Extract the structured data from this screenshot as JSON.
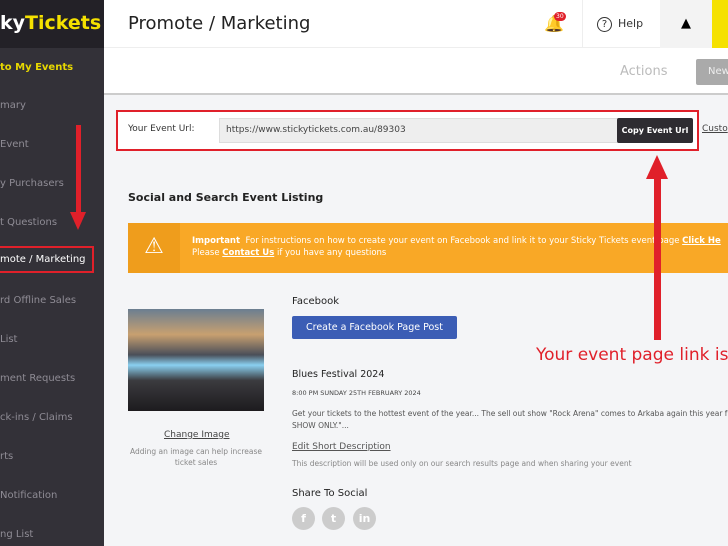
{
  "brand": {
    "logo_pre": "ky",
    "logo_post": "Tickets"
  },
  "sidebar": {
    "items": [
      {
        "label": "to My Events"
      },
      {
        "label": "mary"
      },
      {
        "label": "Event"
      },
      {
        "label": "y Purchasers"
      },
      {
        "label": "t Questions"
      },
      {
        "label": "mote / Marketing"
      },
      {
        "label": "rd Offline Sales"
      },
      {
        "label": "List"
      },
      {
        "label": "ment Requests"
      },
      {
        "label": "ck-ins / Claims"
      },
      {
        "label": "rts"
      },
      {
        "label": "Notification"
      },
      {
        "label": "ng List"
      }
    ]
  },
  "header": {
    "title": "Promote / Marketing",
    "notification_count": "30",
    "help": "Help"
  },
  "subbar": {
    "actions": "Actions",
    "new": "New"
  },
  "url": {
    "label": "Your Event Url:",
    "value": "https://www.stickytickets.com.au/89303",
    "copy": "Copy Event Url",
    "custom": "Custo"
  },
  "section": {
    "title": "Social and Search Event Listing"
  },
  "alert": {
    "strong": "Important",
    "text1": "For instructions on how to create your event on Facebook and link it to your Sticky Tickets event page",
    "link1": "Click He",
    "text2a": "Please",
    "link2": "Contact Us",
    "text2b": "if you have any questions"
  },
  "image": {
    "change": "Change Image",
    "hint": "Adding an image can help increase ticket sales"
  },
  "facebook": {
    "label": "Facebook",
    "button": "Create a Facebook Page Post"
  },
  "event": {
    "name": "Blues Festival 2024",
    "date": "8:00 PM SUNDAY 25TH FEBRUARY 2024",
    "desc1": "Get your tickets to the hottest event of the year... The sell out show \"Rock Arena\" comes to Arkaba again this year f",
    "desc2": "SHOW ONLY.\"...",
    "edit": "Edit Short Description",
    "hint": "This description will be used only on our search results page and when sharing your event"
  },
  "share": {
    "label": "Share To Social",
    "icons": [
      "facebook-icon",
      "twitter-icon",
      "linkedin-icon"
    ]
  },
  "annotation": {
    "text": "Your event page link is"
  },
  "colors": {
    "accent": "#f5e100",
    "alert": "#f9a826",
    "annotation": "#e0202a",
    "facebook": "#3b5db5"
  }
}
